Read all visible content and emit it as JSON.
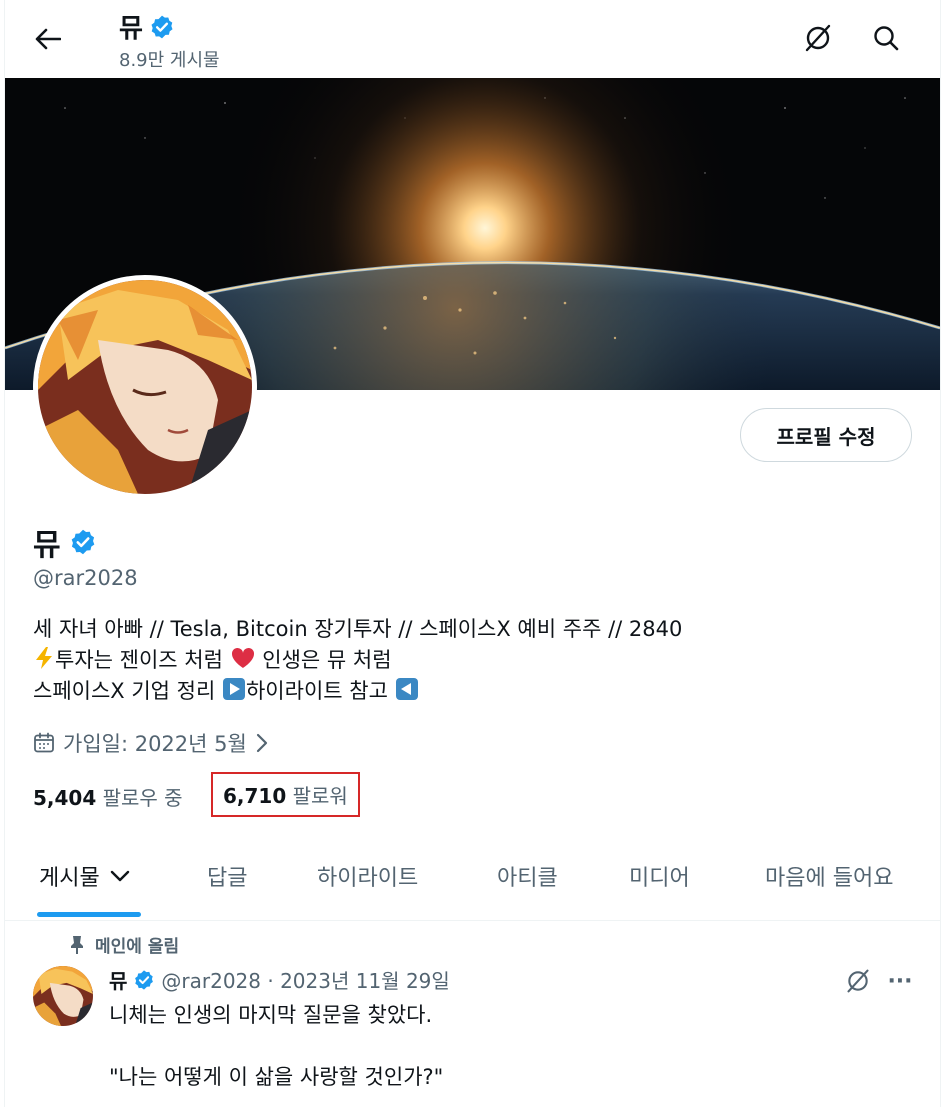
{
  "header": {
    "name": "뮤",
    "post_count": "8.9만 게시물"
  },
  "profile": {
    "edit_button": "프로필 수정",
    "name": "뮤",
    "handle": "@rar2028",
    "bio": {
      "line1": "세 자녀 아빠 // Tesla, Bitcoin 장기투자 // 스페이스X 예비 주주 // 2840",
      "line2_a": "투자는 젠이즈 처럼",
      "line2_b": "인생은 뮤 처럼",
      "line3_a": "스페이스X 기업 정리",
      "line3_b": "하이라이트 참고"
    },
    "joined": "가입일: 2022년 5월",
    "following_count": "5,404",
    "following_label": "팔로우 중",
    "followers_count": "6,710",
    "followers_label": "팔로워"
  },
  "tabs": [
    "게시물",
    "답글",
    "하이라이트",
    "아티클",
    "미디어",
    "마음에 들어요"
  ],
  "post": {
    "pinned_label": "메인에 올림",
    "name": "뮤",
    "meta": "@rar2028 · 2023년 11월 29일",
    "more": "···",
    "line1": "니체는 인생의 마지막 질문을 찾았다.",
    "line2": "\"나는 어떻게 이 삶을 사랑할 것인가?\""
  },
  "colors": {
    "accent": "#1d9bf0",
    "highlight_box": "#d62828",
    "secondary_text": "#536471"
  },
  "icons": [
    "back-arrow-icon",
    "verified-badge-icon",
    "grok-icon",
    "search-icon",
    "calendar-icon",
    "chevron-right-icon",
    "chevron-down-icon",
    "pin-icon",
    "more-icon",
    "lightning-emoji",
    "heart-emoji",
    "play-emoji",
    "reverse-emoji"
  ]
}
